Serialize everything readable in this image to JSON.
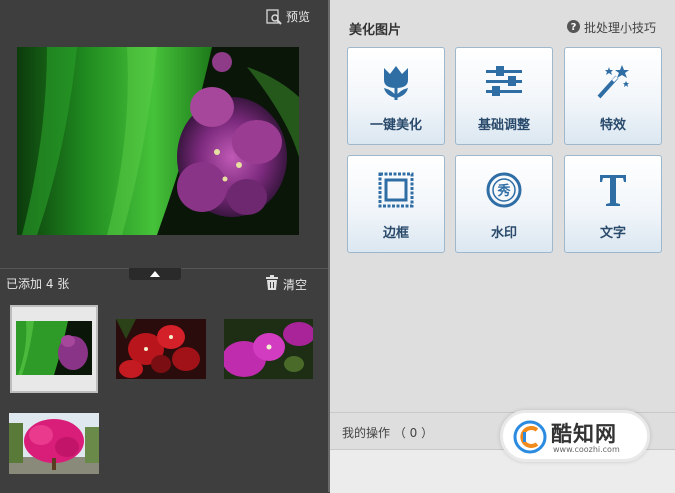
{
  "left_panel": {
    "preview_label": "预览",
    "added_count": "已添加 4 张",
    "clear_label": "清空",
    "thumbnails": [
      {
        "subject": "green-leaf-purple-flower",
        "selected": true
      },
      {
        "subject": "red-bougainvillea"
      },
      {
        "subject": "purple-flower-closeup"
      },
      {
        "subject": "pink-flowering-tree"
      }
    ]
  },
  "right_panel": {
    "title": "美化图片",
    "tips_label": "批处理小技巧",
    "tiles": [
      {
        "label": "一键美化",
        "icon": "tulip-icon"
      },
      {
        "label": "基础调整",
        "icon": "sliders-icon"
      },
      {
        "label": "特效",
        "icon": "magic-wand-icon"
      },
      {
        "label": "边框",
        "icon": "frame-icon"
      },
      {
        "label": "水印",
        "icon": "watermark-seal-icon"
      },
      {
        "label": "文字",
        "icon": "text-t-icon"
      }
    ],
    "operations_label": "我的操作 （ 0 ）"
  },
  "watermark": {
    "brand": "酷知网",
    "url": "www.coozhi.com"
  },
  "colors": {
    "left_bg": "#3e3e3e",
    "right_bg": "#dedede",
    "tile_label": "#2a4a6b",
    "icon_blue": "#2f6ea5"
  }
}
